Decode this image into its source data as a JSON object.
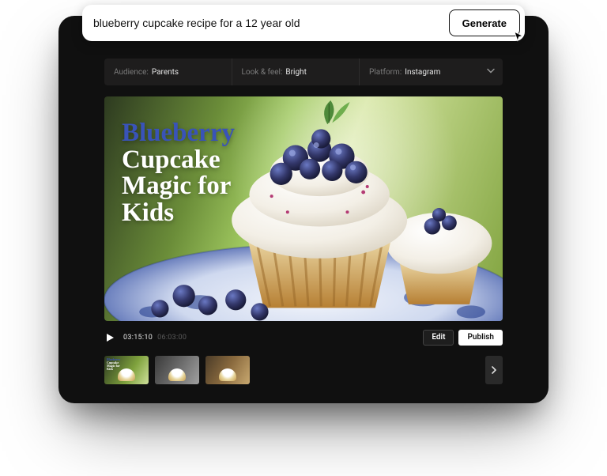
{
  "prompt": {
    "value": "blueberry cupcake recipe for a 12 year old",
    "generate_label": "Generate"
  },
  "options": {
    "audience": {
      "label": "Audience:",
      "value": "Parents"
    },
    "look": {
      "label": "Look & feel:",
      "value": "Bright"
    },
    "platform": {
      "label": "Platform:",
      "value": "Instagram"
    }
  },
  "title": {
    "line1": "Blueberry",
    "line2": "Cupcake",
    "line3": "Magic for",
    "line4": "Kids"
  },
  "controls": {
    "current_time": "03:15:10",
    "total_time": "06:03:00",
    "edit_label": "Edit",
    "publish_label": "Publish"
  },
  "thumbs": {
    "mini_line1": "Blueberry",
    "mini_line2": "Cupcake",
    "mini_line3": "Magic for",
    "mini_line4": "Kids"
  }
}
